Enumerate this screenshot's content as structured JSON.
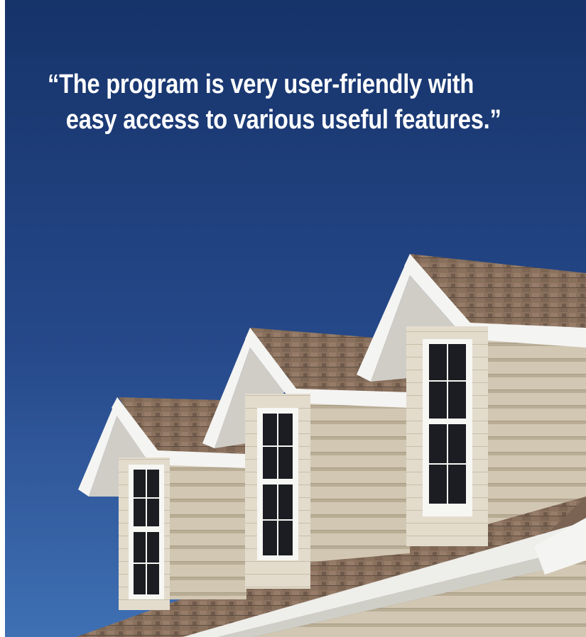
{
  "quote": {
    "line1": "“The program is very user-friendly with",
    "line2": "easy access to various useful features.”"
  },
  "colors": {
    "sky_top": "#16336a",
    "sky_bottom": "#3f70b4",
    "roof_shingles": "#8a715e",
    "siding": "#d2c7b2",
    "trim": "#f4f4f2",
    "window_glass": "#1b1d22",
    "quote_text": "#ffffff"
  },
  "image": {
    "subject": "three dormer windows on a shingled house roof under a clear blue sky"
  }
}
